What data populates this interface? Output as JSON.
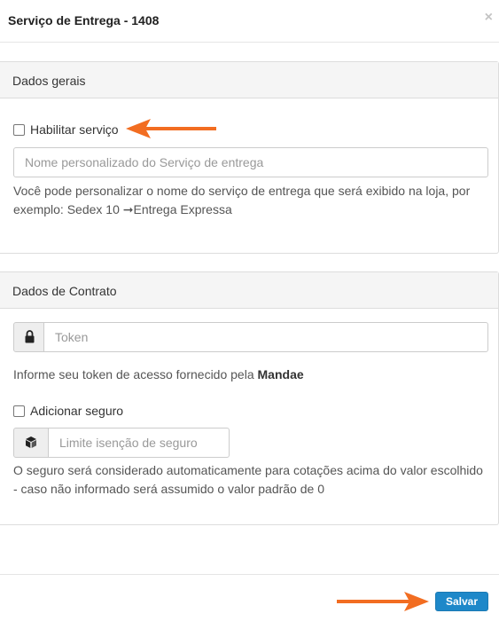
{
  "modal": {
    "title": "Serviço de Entrega - 1408",
    "close_glyph": "×"
  },
  "general": {
    "heading": "Dados gerais",
    "enable_label": "Habilitar serviço",
    "enable_checked": false,
    "name_placeholder": "Nome personalizado do Serviço de entrega",
    "help_line1": "Você pode personalizar o nome do serviço de entrega que será exibido na loja, por",
    "help_line2": "exemplo: Sedex 10 ➞Entrega Expressa"
  },
  "contract": {
    "heading": "Dados de Contrato",
    "token_icon": "lock-icon",
    "token_placeholder": "Token",
    "token_help_prefix": "Informe seu token de acesso fornecido pela ",
    "token_help_brand": "Mandae",
    "insurance_label": "Adicionar seguro",
    "insurance_checked": false,
    "insurance_icon": "cube-icon",
    "insurance_placeholder": "Limite isenção de seguro",
    "insurance_help_line1": "O seguro será considerado automaticamente para cotações acima do valor escolhido",
    "insurance_help_line2": "- caso não informado será assumido o valor padrão de 0"
  },
  "footer": {
    "save_label": "Salvar"
  },
  "colors": {
    "accent_button": "#1e88c9",
    "annotation_arrow": "#f26d21"
  }
}
